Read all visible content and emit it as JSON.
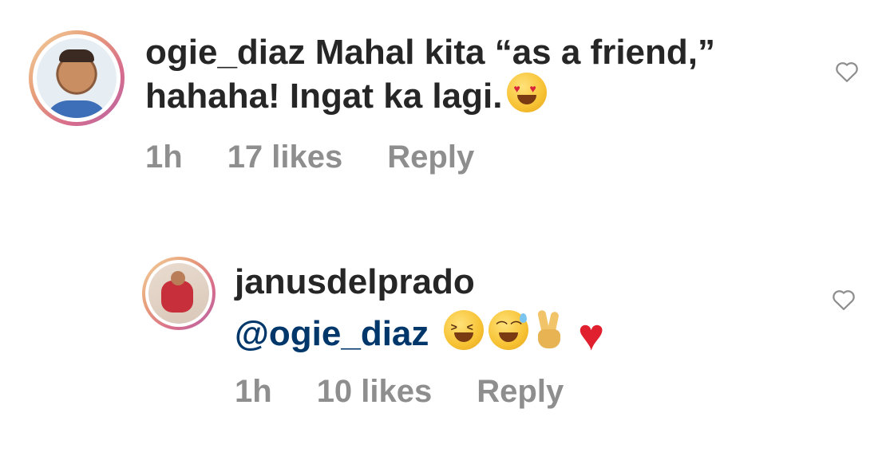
{
  "comments": [
    {
      "username": "ogie_diaz",
      "text": "Mahal kita “as a friend,” hahaha! Ingat ka lagi.",
      "emojis": [
        "heart-eyes-emoji"
      ],
      "time": "1h",
      "likes": "17 likes",
      "reply_label": "Reply"
    },
    {
      "username": "janusdelprado",
      "mention": "@ogie_diaz",
      "emojis": [
        "grinning-squinting-emoji",
        "grinning-sweat-emoji",
        "victory-hand-emoji",
        "red-heart-emoji"
      ],
      "time": "1h",
      "likes": "10 likes",
      "reply_label": "Reply"
    }
  ],
  "icons": {
    "like": "heart-outline-icon"
  },
  "colors": {
    "text": "#262626",
    "meta": "#8e8e8e",
    "mention": "#00376b",
    "heart_emoji": "#e0202e"
  }
}
